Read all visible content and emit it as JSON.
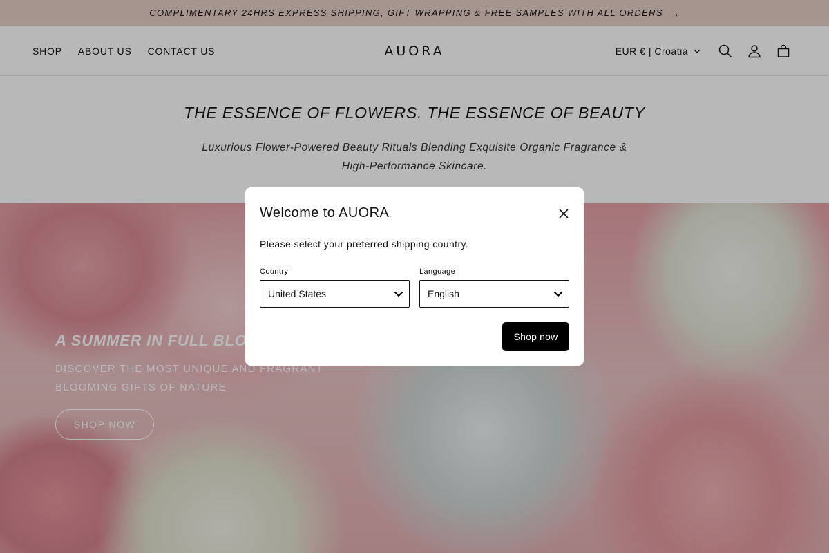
{
  "announcement": {
    "text": "COMPLIMENTARY 24HRS EXPRESS SHIPPING, GIFT WRAPPING & FREE SAMPLES WITH ALL ORDERS",
    "arrow": "→"
  },
  "header": {
    "nav": [
      "SHOP",
      "ABOUT US",
      "CONTACT US"
    ],
    "logo": "AUORA",
    "locale": "EUR € | Croatia",
    "icons": [
      "search-icon",
      "account-icon",
      "cart-icon"
    ]
  },
  "intro": {
    "title": "THE ESSENCE OF FLOWERS. THE ESSENCE OF BEAUTY",
    "subtitle": "Luxurious Flower-Powered Beauty Rituals Blending Exquisite Organic Fragrance & High-Performance Skincare."
  },
  "banner": {
    "title": "A SUMMER IN FULL BLOOM",
    "subtitle": "DISCOVER THE MOST UNIQUE AND FRAGRANT BLOOMING GIFTS OF NATURE",
    "button": "SHOP NOW"
  },
  "modal": {
    "title": "Welcome to AUORA",
    "description": "Please select your preferred shipping country.",
    "country_label": "Country",
    "country_value": "United States",
    "language_label": "Language",
    "language_value": "English",
    "submit": "Shop now"
  },
  "colors": {
    "announcement_bg": "#e6cdc6",
    "button_bg": "#000000"
  }
}
